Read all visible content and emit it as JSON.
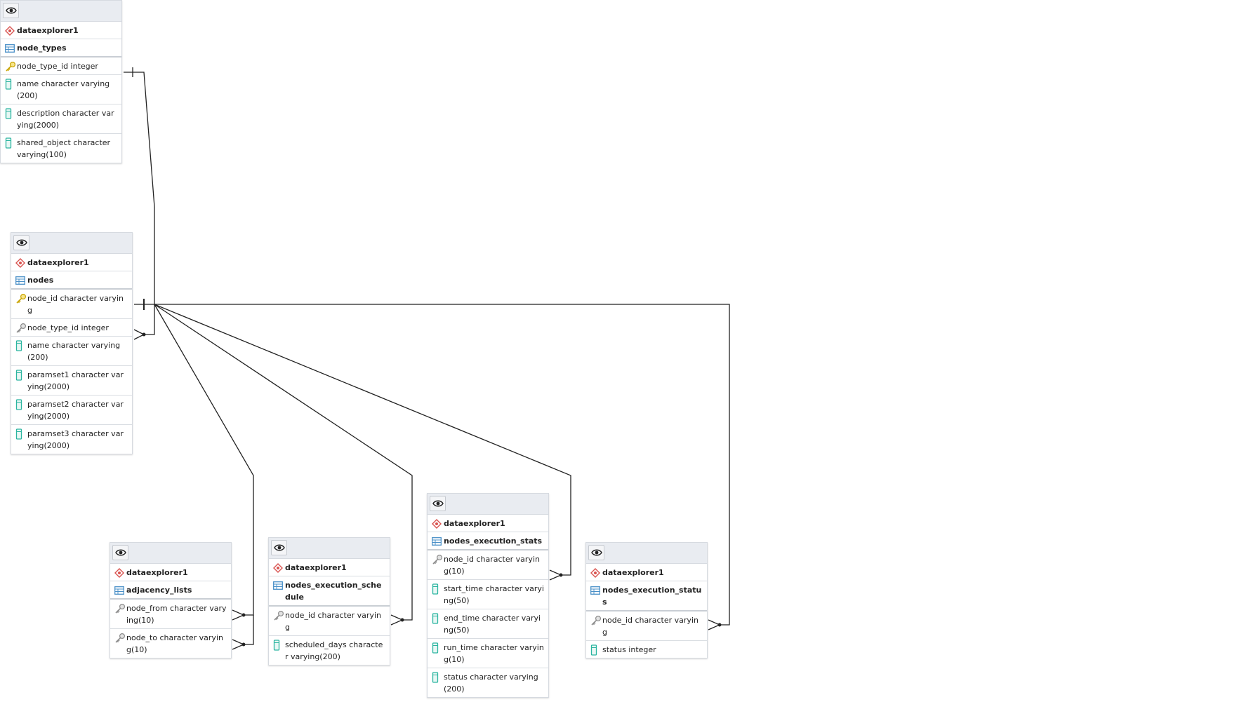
{
  "colors": {
    "schema_icon": "#d9534f",
    "table_icon": "#4a90c8",
    "pk_icon": "#e6c229",
    "fk_icon": "#8c8c8c",
    "column_icon": "#2bb5a0",
    "header_bg": "#e9ecf1",
    "edge": "#222222"
  },
  "tables": [
    {
      "id": "node_types",
      "schema": "dataexplorer1",
      "name": "node_types",
      "columns": [
        {
          "label": "node_type_id integer",
          "icon": "primary-key-icon"
        },
        {
          "label": "name character varying(200)",
          "icon": "column-icon"
        },
        {
          "label": "description character varying(2000)",
          "icon": "column-icon"
        },
        {
          "label": "shared_object character varying(100)",
          "icon": "column-icon"
        }
      ]
    },
    {
      "id": "nodes",
      "schema": "dataexplorer1",
      "name": "nodes",
      "columns": [
        {
          "label": "node_id character varying",
          "icon": "primary-key-icon"
        },
        {
          "label": "node_type_id integer",
          "icon": "foreign-key-icon"
        },
        {
          "label": "name character varying(200)",
          "icon": "column-icon"
        },
        {
          "label": "paramset1 character varying(2000)",
          "icon": "column-icon"
        },
        {
          "label": "paramset2 character varying(2000)",
          "icon": "column-icon"
        },
        {
          "label": "paramset3 character varying(2000)",
          "icon": "column-icon"
        }
      ]
    },
    {
      "id": "adjacency_lists",
      "schema": "dataexplorer1",
      "name": "adjacency_lists",
      "columns": [
        {
          "label": "node_from character varying(10)",
          "icon": "foreign-key-icon"
        },
        {
          "label": "node_to character varying(10)",
          "icon": "foreign-key-icon"
        }
      ]
    },
    {
      "id": "nodes_execution_schedule",
      "schema": "dataexplorer1",
      "name": "nodes_execution_schedule",
      "columns": [
        {
          "label": "node_id character varying",
          "icon": "foreign-key-icon"
        },
        {
          "label": "scheduled_days character varying(200)",
          "icon": "column-icon"
        }
      ]
    },
    {
      "id": "nodes_execution_stats",
      "schema": "dataexplorer1",
      "name": "nodes_execution_stats",
      "columns": [
        {
          "label": "node_id character varying(10)",
          "icon": "foreign-key-icon"
        },
        {
          "label": "start_time character varying(50)",
          "icon": "column-icon"
        },
        {
          "label": "end_time character varying(50)",
          "icon": "column-icon"
        },
        {
          "label": "run_time character varying(10)",
          "icon": "column-icon"
        },
        {
          "label": "status character varying(200)",
          "icon": "column-icon"
        }
      ]
    },
    {
      "id": "nodes_execution_status",
      "schema": "dataexplorer1",
      "name": "nodes_execution_status",
      "columns": [
        {
          "label": "node_id character varying",
          "icon": "foreign-key-icon"
        },
        {
          "label": "status integer",
          "icon": "column-icon"
        }
      ]
    }
  ],
  "relationships": [
    {
      "from": "node_types.node_type_id",
      "to": "nodes.node_type_id"
    },
    {
      "from": "nodes.node_id",
      "to": "adjacency_lists.node_from"
    },
    {
      "from": "nodes.node_id",
      "to": "adjacency_lists.node_to"
    },
    {
      "from": "nodes.node_id",
      "to": "nodes_execution_schedule.node_id"
    },
    {
      "from": "nodes.node_id",
      "to": "nodes_execution_stats.node_id"
    },
    {
      "from": "nodes.node_id",
      "to": "nodes_execution_status.node_id"
    }
  ]
}
